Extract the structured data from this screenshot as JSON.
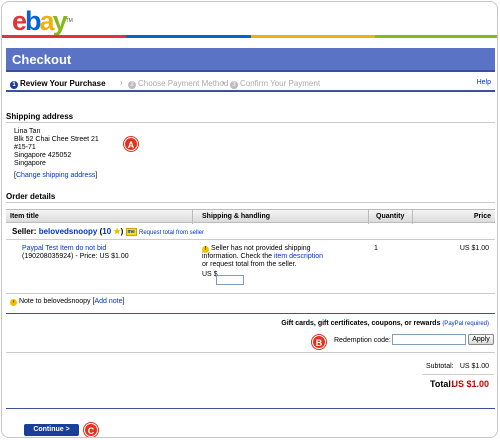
{
  "brand": {
    "logo_e": "e",
    "logo_b": "b",
    "logo_a": "a",
    "logo_y": "y",
    "tm": "TM"
  },
  "brand_colors": [
    "#e53238",
    "#0064d2",
    "#f5af02",
    "#86b817"
  ],
  "header": {
    "title": "Checkout",
    "help": "Help"
  },
  "steps": [
    {
      "num": "1",
      "label": "Review Your Purchase"
    },
    {
      "num": "2",
      "label": "Choose Payment Method"
    },
    {
      "num": "3",
      "label": "Confirm Your Payment"
    }
  ],
  "step_arrow": "›",
  "shipping": {
    "title": "Shipping address",
    "lines": [
      "Lina Tan",
      "Blk 52 Chai Chee Street 21",
      "#15-71",
      "Singapore 425052",
      "Singapore"
    ],
    "change_link": "Change shipping address",
    "bracket_open": "[",
    "bracket_close": "]"
  },
  "order": {
    "title": "Order details",
    "columns": {
      "item": "Item title",
      "shipping": "Shipping & handling",
      "quantity": "Quantity",
      "price": "Price"
    },
    "seller_label": "Seller:",
    "seller_name": "belovedsnoopy",
    "feedback_open": "(",
    "feedback": "10",
    "feedback_close": ")",
    "request_total": "Request total from seller",
    "me_badge": "me",
    "item_title": "Paypal Test Item do not bid",
    "item_meta": "(190208035924) - Price: US $1.00",
    "shipping_msg_1": "Seller has not provided shipping",
    "shipping_msg_2a": "information. Check the",
    "shipping_msg_link": "item description",
    "shipping_msg_3": "or request total from the seller.",
    "shipping_currency": "US $",
    "quantity": "1",
    "price": "US $1.00",
    "note_label": "Note to belovedsnoopy",
    "add_note": "Add note"
  },
  "gift": {
    "title": "Gift cards, gift certificates, coupons, or rewards",
    "paypal_required": "(PayPal required)",
    "code_label": "Redemption code:",
    "apply": "Apply"
  },
  "totals": {
    "subtotal_label": "Subtotal:",
    "subtotal": "US $1.00",
    "total_label": "Total:",
    "total": "US $1.00"
  },
  "actions": {
    "continue": "Continue >"
  },
  "callouts": [
    "A",
    "B",
    "C"
  ],
  "icons": [
    "step-number-icon",
    "chevron-right-icon",
    "star-icon",
    "me-icon",
    "warning-icon",
    "note-icon"
  ]
}
